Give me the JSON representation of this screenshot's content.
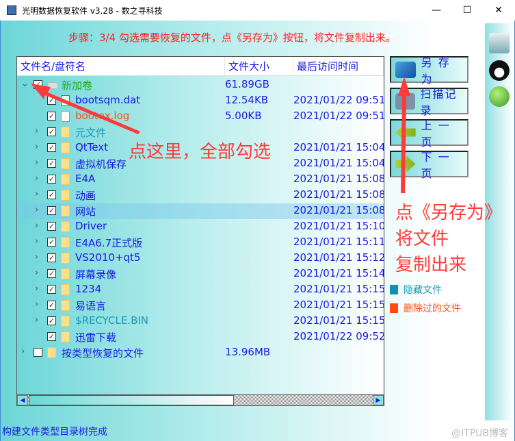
{
  "window": {
    "title": "光明数据恢复软件 v3.28 - 数之寻科技",
    "minimize": "—",
    "maximize": "☐",
    "close": "✕"
  },
  "step_text": "步骤：3/4 勾选需要恢复的文件，点《另存为》按钮，将文件复制出来。",
  "tree": {
    "columns": [
      "文件名/盘符名",
      "文件大小",
      "最后访问时间"
    ],
    "rows": [
      {
        "name": "新加卷",
        "size": "61.89GB",
        "date": "",
        "level": 1,
        "expand": "⌄",
        "checked": true,
        "icon": "drive",
        "color": "#22aa22"
      },
      {
        "name": "bootsqm.dat",
        "size": "12.54KB",
        "date": "2021/01/22 09:51",
        "level": 2,
        "expand": "",
        "checked": true,
        "icon": "dat",
        "color": "#1a1ae0"
      },
      {
        "name": "bootex.log",
        "size": "5.00KB",
        "date": "2021/01/22 09:51",
        "level": 2,
        "expand": "",
        "checked": true,
        "icon": "file",
        "color": "#ff5010"
      },
      {
        "name": "元文件",
        "size": "",
        "date": "",
        "level": 2,
        "expand": "›",
        "checked": true,
        "icon": "folder",
        "color": "#1a9ab0"
      },
      {
        "name": "QtText",
        "size": "",
        "date": "2021/01/21 15:04",
        "level": 2,
        "expand": "›",
        "checked": true,
        "icon": "folder",
        "color": "#1a1ae0"
      },
      {
        "name": "虚拟机保存",
        "size": "",
        "date": "2021/01/21 15:04",
        "level": 2,
        "expand": "›",
        "checked": true,
        "icon": "folder",
        "color": "#1a1ae0"
      },
      {
        "name": "E4A",
        "size": "",
        "date": "2021/01/21 15:08",
        "level": 2,
        "expand": "›",
        "checked": true,
        "icon": "folder",
        "color": "#1a1ae0"
      },
      {
        "name": "动画",
        "size": "",
        "date": "2021/01/21 15:08",
        "level": 2,
        "expand": "›",
        "checked": true,
        "icon": "folder",
        "color": "#1a1ae0"
      },
      {
        "name": "网站",
        "size": "",
        "date": "2021/01/21 15:08",
        "level": 2,
        "expand": "›",
        "checked": true,
        "icon": "folder",
        "color": "#1a1ae0",
        "selected": true
      },
      {
        "name": "Driver",
        "size": "",
        "date": "2021/01/21 15:10",
        "level": 2,
        "expand": "›",
        "checked": true,
        "icon": "folder",
        "color": "#1a1ae0"
      },
      {
        "name": "E4A6.7正式版",
        "size": "",
        "date": "2021/01/21 15:11",
        "level": 2,
        "expand": "›",
        "checked": true,
        "icon": "folder",
        "color": "#1a1ae0"
      },
      {
        "name": "VS2010+qt5",
        "size": "",
        "date": "2021/01/21 15:12",
        "level": 2,
        "expand": "›",
        "checked": true,
        "icon": "folder",
        "color": "#1a1ae0"
      },
      {
        "name": "屏幕录像",
        "size": "",
        "date": "2021/01/21 15:14",
        "level": 2,
        "expand": "›",
        "checked": true,
        "icon": "folder",
        "color": "#1a1ae0"
      },
      {
        "name": "1234",
        "size": "",
        "date": "2021/01/21 15:15",
        "level": 2,
        "expand": "›",
        "checked": true,
        "icon": "folder",
        "color": "#1a1ae0"
      },
      {
        "name": "易语言",
        "size": "",
        "date": "2021/01/21 15:15",
        "level": 2,
        "expand": "›",
        "checked": true,
        "icon": "folder",
        "color": "#1a1ae0"
      },
      {
        "name": "$RECYCLE.BIN",
        "size": "",
        "date": "2021/01/21 15:15",
        "level": 2,
        "expand": "›",
        "checked": true,
        "icon": "folder",
        "color": "#1a9ab0"
      },
      {
        "name": "迅雷下载",
        "size": "",
        "date": "2021/01/22 09:52",
        "level": 2,
        "expand": "",
        "checked": true,
        "icon": "folder",
        "color": "#1a1ae0"
      },
      {
        "name": "按类型恢复的文件",
        "size": "13.96MB",
        "date": "",
        "level": 1,
        "expand": "›",
        "checked": false,
        "icon": "folder",
        "color": "#1a1ae0"
      }
    ]
  },
  "buttons": {
    "save_as": "另 存 为",
    "scan_log": "扫描记录",
    "prev_page": "上 一 页",
    "next_page": "下 一 页"
  },
  "legend": [
    {
      "label": "隐藏文件",
      "color": "#1a9ab0"
    },
    {
      "label": "删除过的文件",
      "color": "#ff5010"
    }
  ],
  "status": "构建文件类型目录树完成",
  "watermark": "@ITPUB博客",
  "annotations": {
    "check_all": "点这里，全部勾选",
    "save_as_hint": [
      "点《另存为》将文件",
      "复制出来"
    ]
  }
}
